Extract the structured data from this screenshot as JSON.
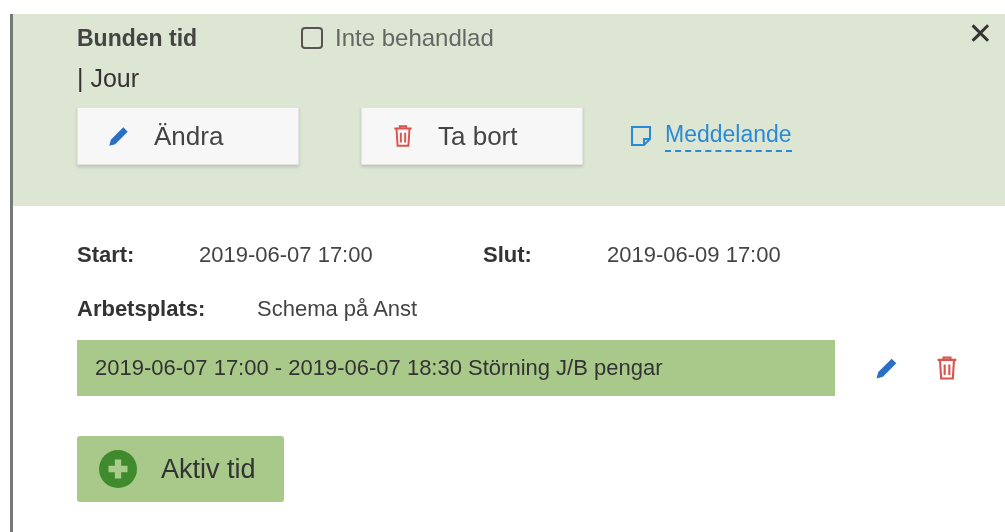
{
  "header": {
    "title": "Bunden tid",
    "checkbox": {
      "label": "Inte behandlad",
      "checked": false
    },
    "subtitle": "| Jour",
    "close": "✕",
    "buttons": [
      {
        "kind": "edit",
        "label": "Ändra"
      },
      {
        "kind": "delete",
        "label": "Ta bort"
      }
    ],
    "link": "Meddelande"
  },
  "details": {
    "start_label": "Start:",
    "start": "2019-06-07  17:00",
    "end_label": "Slut:",
    "end": "2019-06-09  17:00",
    "workplace_label": "Arbetsplats:",
    "workplace": "Schema på Anst"
  },
  "entries": [
    {
      "text": "2019-06-07 17:00  -  2019-06-07 18:30 Störning J/B pengar"
    }
  ],
  "add_button": "Aktiv tid"
}
